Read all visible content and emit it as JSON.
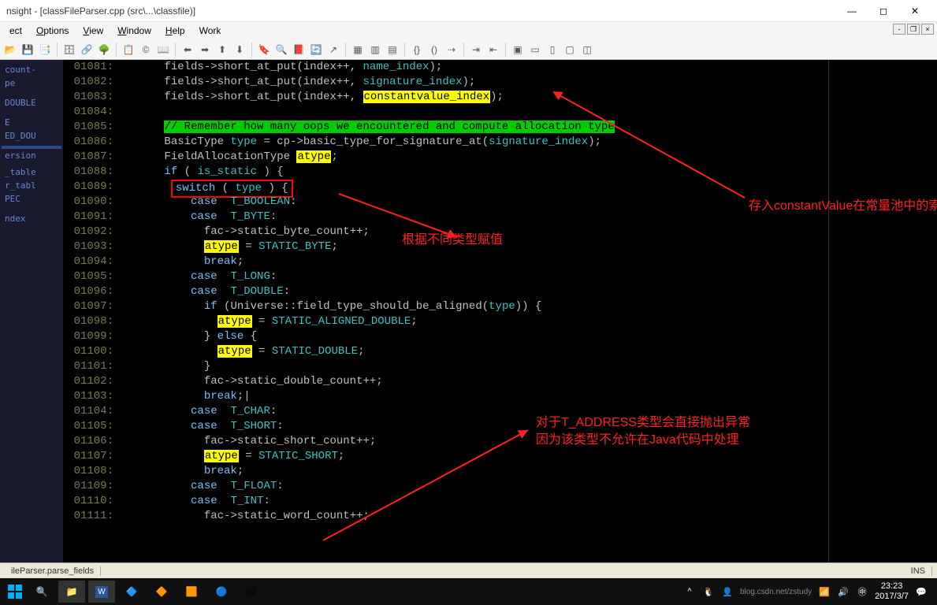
{
  "title": "nsight - [classFileParser.cpp (src\\...\\classfile)]",
  "menus": [
    "ect",
    "Options",
    "View",
    "Window",
    "Help",
    "Work"
  ],
  "menu_accelerators": [
    "",
    "O",
    "V",
    "W",
    "H",
    ""
  ],
  "sidebar": {
    "items": [
      {
        "label": "count-"
      },
      {
        "label": "pe"
      },
      {
        "label": ""
      },
      {
        "label": ""
      },
      {
        "label": "DOUBLE"
      },
      {
        "label": ""
      },
      {
        "label": ""
      },
      {
        "label": "E"
      },
      {
        "label": "ED_DOU"
      },
      {
        "label": ""
      },
      {
        "label": "",
        "sel": true
      },
      {
        "label": "ersion"
      },
      {
        "label": ""
      },
      {
        "label": "_table"
      },
      {
        "label": "r_tabl"
      },
      {
        "label": "PEC"
      },
      {
        "label": ""
      },
      {
        "label": ""
      },
      {
        "label": "ndex"
      },
      {
        "label": ""
      }
    ]
  },
  "lines": [
    {
      "no": "01081",
      "html": "      <span class='ident'>fields</span>-><span class='fn'>short_at_put</span>(<span class='ident'>index</span>++, <span class='hl-cyan'>name_index</span>);"
    },
    {
      "no": "01082",
      "html": "      <span class='ident'>fields</span>-><span class='fn'>short_at_put</span>(<span class='ident'>index</span>++, <span class='hl-cyan'>signature_index</span>);"
    },
    {
      "no": "01083",
      "html": "      <span class='ident'>fields</span>-><span class='fn'>short_at_put</span>(<span class='ident'>index</span>++, <span class='hl-yellow'>constantvalue_index</span>);"
    },
    {
      "no": "01084",
      "html": ""
    },
    {
      "no": "01085",
      "html": "      <span class='hl-green'>// Remember how many oops we encountered and compute allocation type</span>"
    },
    {
      "no": "01086",
      "html": "      <span class='ident'>BasicType</span> <span class='hl-cyan'>type</span> = <span class='ident'>cp</span>-><span class='fn'>basic_type_for_signature_at</span>(<span class='hl-cyan'>signature_index</span>);"
    },
    {
      "no": "01087",
      "html": "      <span class='ident'>FieldAllocationType</span> <span class='hl-yellow'>atype</span>;"
    },
    {
      "no": "01088",
      "html": "      <span class='kw'>if</span> ( <span class='hl-cyan'>is_static</span> ) {"
    },
    {
      "no": "01089",
      "html": "       <span class='redbox'><span class='kw'>switch</span> ( <span class='hl-cyan'>type</span> ) {</span>"
    },
    {
      "no": "01090",
      "html": "          <span class='kw'>case</span>  <span class='hl-cyan'>T_BOOLEAN</span>:"
    },
    {
      "no": "01091",
      "html": "          <span class='kw'>case</span>  <span class='hl-cyan'>T_BYTE</span>:"
    },
    {
      "no": "01092",
      "html": "            <span class='ident'>fac</span>-><span class='ident'>static_byte_count</span>++;"
    },
    {
      "no": "01093",
      "html": "            <span class='hl-yellow'>atype</span> = <span class='hl-cyan'>STATIC_BYTE</span>;"
    },
    {
      "no": "01094",
      "html": "            <span class='kw'>break</span>;"
    },
    {
      "no": "01095",
      "html": "          <span class='kw'>case</span>  <span class='hl-cyan'>T_LONG</span>:"
    },
    {
      "no": "01096",
      "html": "          <span class='kw'>case</span>  <span class='hl-cyan'>T_DOUBLE</span>:"
    },
    {
      "no": "01097",
      "html": "            <span class='kw'>if</span> (<span class='ident'>Universe</span>::<span class='fn'>field_type_should_be_aligned</span>(<span class='hl-cyan'>type</span>)) {"
    },
    {
      "no": "01098",
      "html": "              <span class='hl-yellow'>atype</span> = <span class='hl-cyan'>STATIC_ALIGNED_DOUBLE</span>;"
    },
    {
      "no": "01099",
      "html": "            } <span class='kw'>else</span> {"
    },
    {
      "no": "01100",
      "html": "              <span class='hl-yellow'>atype</span> = <span class='hl-cyan'>STATIC_DOUBLE</span>;"
    },
    {
      "no": "01101",
      "html": "            }"
    },
    {
      "no": "01102",
      "html": "            <span class='ident'>fac</span>-><span class='ident'>static_double_count</span>++;"
    },
    {
      "no": "01103",
      "html": "            <span class='kw'>break</span>;|"
    },
    {
      "no": "01104",
      "html": "          <span class='kw'>case</span>  <span class='hl-cyan'>T_CHAR</span>:"
    },
    {
      "no": "01105",
      "html": "          <span class='kw'>case</span>  <span class='hl-cyan'>T_SHORT</span>:"
    },
    {
      "no": "01106",
      "html": "            <span class='ident'>fac</span>-><span class='ident'>static_short_count</span>++;"
    },
    {
      "no": "01107",
      "html": "            <span class='hl-yellow'>atype</span> = <span class='hl-cyan'>STATIC_SHORT</span>;"
    },
    {
      "no": "01108",
      "html": "            <span class='kw'>break</span>;"
    },
    {
      "no": "01109",
      "html": "          <span class='kw'>case</span>  <span class='hl-cyan'>T_FLOAT</span>:"
    },
    {
      "no": "01110",
      "html": "          <span class='kw'>case</span>  <span class='hl-cyan'>T_INT</span>:"
    },
    {
      "no": "01111",
      "html": "            <span class='ident'>fac</span>-><span class='ident'>static_word_count</span>++;"
    }
  ],
  "annotations": {
    "a1": "根据不同类型赋值",
    "a2": "存入constantValue在常量池中的索引，方便后面对含有该属性的常量赋初始值",
    "a3": "对于T_ADDRESS类型会直接抛出异常\n因为该类型不允许在Java代码中处理"
  },
  "status": {
    "left": "ileParser.parse_fields",
    "ins": "INS"
  },
  "clock": {
    "time": "23:23",
    "date": "2017/3/7"
  },
  "watermark": "blog.csdn.net/zstudy"
}
